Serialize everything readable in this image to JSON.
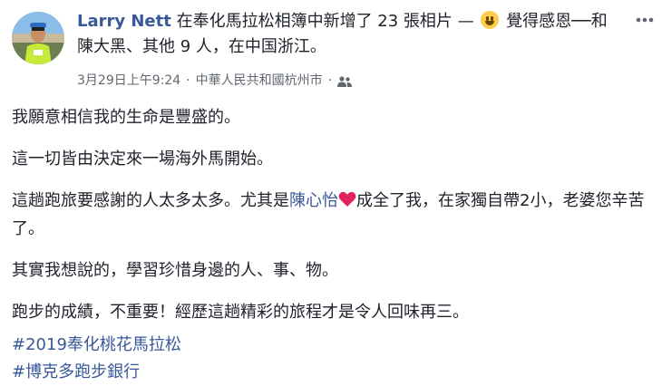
{
  "header": {
    "author": "Larry Nett",
    "action": " 在奉化馬拉松相簿中新增了 23 張相片 — ",
    "feeling_icon": "grinning-face-icon",
    "feeling": " 覺得感恩──和",
    "tagged_person": "陳大黑",
    "tagged_others": "、其他 9 人",
    "location_prefix": "，在",
    "location": "中国浙江",
    "end": "。"
  },
  "meta": {
    "timestamp": "3月29日上午9:24",
    "separator": "·",
    "place": "中華人民共和國杭州市",
    "audience_icon": "friends-icon"
  },
  "menu_icon": "more-horizontal-icon",
  "body": {
    "p1": "我願意相信我的生命是豐盛的。",
    "p2": "這一切皆由決定來一場海外馬開始。",
    "p3_before": "這趟跑旅要感謝的人太多太多。尤其是",
    "p3_mention": "陳心怡",
    "p3_heart_icon": "red-heart-icon",
    "p3_after": "成全了我，在家獨自帶2小，老婆您辛苦了。",
    "p4": "其實我想說的，學習珍惜身邊的人、事、物。",
    "p5": "跑步的成績，不重要！經歷這趟精彩的旅程才是令人回味再三。",
    "hashtags": [
      "#2019奉化桃花馬拉松",
      "#博克多跑步銀行"
    ]
  },
  "colors": {
    "link": "#385898",
    "text": "#1d2129",
    "meta": "#606770",
    "heart": "#e0245e"
  }
}
